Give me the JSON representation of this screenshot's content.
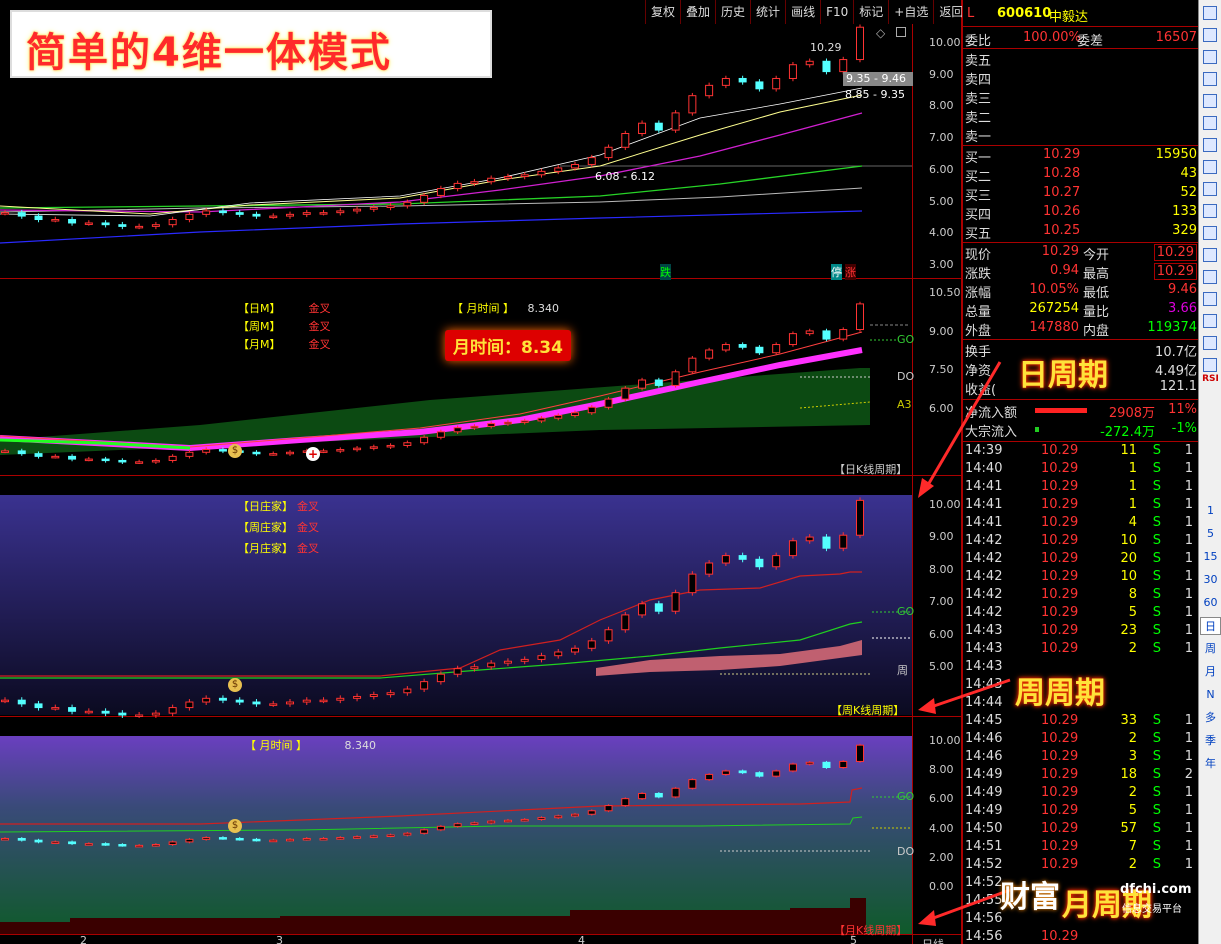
{
  "banner": {
    "title": "简单的4维一体模式"
  },
  "toolbar": [
    "复权",
    "叠加",
    "历史",
    "统计",
    "画线",
    "F10",
    "标记",
    "+自选",
    "返回"
  ],
  "stock": {
    "flag": "L",
    "code": "600610",
    "name": "中毅达"
  },
  "panel1": {
    "yticks": [
      "10.00",
      "9.00",
      "8.00",
      "7.00",
      "6.00",
      "5.00",
      "4.00",
      "3.00"
    ],
    "labels": {
      "price_top": "10.29",
      "range1": "9.35 - 9.46",
      "range2": "8.85 - 9.35",
      "range3": "6.08 - 6.12",
      "die": "跌",
      "ting": "停",
      "zhang": "涨"
    }
  },
  "panel2": {
    "yticks": [
      "10.50",
      "9.00",
      "7.50",
      "6.00"
    ],
    "legend": [
      {
        "k": "【日M】",
        "v": "金叉"
      },
      {
        "k": "【周M】",
        "v": "金叉"
      },
      {
        "k": "【月M】",
        "v": "金叉"
      }
    ],
    "month_time_label": "【 月时间 】",
    "month_time_value": "8.340",
    "highlight": "月时间：8.34",
    "levels": {
      "go": "GO",
      "do": "DO",
      "a3": "A3"
    },
    "footer": "【日K线周期】"
  },
  "panel3": {
    "yticks": [
      "10.00",
      "9.00",
      "8.00",
      "7.00",
      "6.00",
      "5.00"
    ],
    "legend": [
      {
        "k": "【日庄家】",
        "v": "金叉"
      },
      {
        "k": "【周庄家】",
        "v": "金叉"
      },
      {
        "k": "【月庄家】",
        "v": "金叉"
      }
    ],
    "levels": {
      "go": "GO",
      "zhou": "周"
    },
    "footer": "【周K线周期】"
  },
  "panel4": {
    "yticks": [
      "10.00",
      "8.00",
      "6.00",
      "4.00",
      "2.00",
      "0.00"
    ],
    "month_time_label": "【 月时间 】",
    "month_time_value": "8.340",
    "levels": {
      "go": "GO",
      "do": "DO"
    },
    "footer": "【月K线周期】",
    "xticks": [
      "2",
      "3",
      "4",
      "5"
    ],
    "bottom_label": "日线"
  },
  "callouts": {
    "day": "日周期",
    "week": "周周期",
    "month": "月周期"
  },
  "quote": {
    "weibi_label": "委比",
    "weibi": "100.00%",
    "weicha_label": "委差",
    "weicha": "16507",
    "asks": [
      "卖五",
      "卖四",
      "卖三",
      "卖二",
      "卖一"
    ],
    "bids": [
      {
        "l": "买一",
        "p": "10.29",
        "v": "15950"
      },
      {
        "l": "买二",
        "p": "10.28",
        "v": "43"
      },
      {
        "l": "买三",
        "p": "10.27",
        "v": "52"
      },
      {
        "l": "买四",
        "p": "10.26",
        "v": "133"
      },
      {
        "l": "买五",
        "p": "10.25",
        "v": "329"
      }
    ],
    "stats": [
      {
        "l": "现价",
        "v": "10.29",
        "l2": "今开",
        "v2": "10.29"
      },
      {
        "l": "涨跌",
        "v": "0.94",
        "l2": "最高",
        "v2": "10.29"
      },
      {
        "l": "涨幅",
        "v": "10.05%",
        "l2": "最低",
        "v2": "9.46"
      },
      {
        "l": "总量",
        "v": "267254",
        "l2": "量比",
        "v2": "3.66"
      },
      {
        "l": "外盘",
        "v": "147880",
        "l2": "内盘",
        "v2": "119374"
      }
    ],
    "extra": [
      {
        "l": "换手",
        "v": "10.7亿"
      },
      {
        "l": "净资",
        "v": "4.49亿"
      },
      {
        "l": "收益(",
        "v": "121.1"
      }
    ],
    "flow": [
      {
        "l": "净流入额",
        "v": "2908万",
        "p": "11%"
      },
      {
        "l": "大宗流入",
        "v": "-272.4万",
        "p": "-1%"
      }
    ],
    "ticks": [
      {
        "t": "14:39",
        "p": "10.29",
        "v": "11",
        "s": "S",
        "n": "1"
      },
      {
        "t": "14:40",
        "p": "10.29",
        "v": "1",
        "s": "S",
        "n": "1"
      },
      {
        "t": "14:41",
        "p": "10.29",
        "v": "1",
        "s": "S",
        "n": "1"
      },
      {
        "t": "14:41",
        "p": "10.29",
        "v": "1",
        "s": "S",
        "n": "1"
      },
      {
        "t": "14:41",
        "p": "10.29",
        "v": "4",
        "s": "S",
        "n": "1"
      },
      {
        "t": "14:42",
        "p": "10.29",
        "v": "10",
        "s": "S",
        "n": "1"
      },
      {
        "t": "14:42",
        "p": "10.29",
        "v": "20",
        "s": "S",
        "n": "1"
      },
      {
        "t": "14:42",
        "p": "10.29",
        "v": "10",
        "s": "S",
        "n": "1"
      },
      {
        "t": "14:42",
        "p": "10.29",
        "v": "8",
        "s": "S",
        "n": "1"
      },
      {
        "t": "14:42",
        "p": "10.29",
        "v": "5",
        "s": "S",
        "n": "1"
      },
      {
        "t": "14:43",
        "p": "10.29",
        "v": "23",
        "s": "S",
        "n": "1"
      },
      {
        "t": "14:43",
        "p": "10.29",
        "v": "2",
        "s": "S",
        "n": "1"
      },
      {
        "t": "14:43",
        "p": "",
        "v": "",
        "s": "",
        "n": ""
      },
      {
        "t": "14:43",
        "p": "",
        "v": "",
        "s": "",
        "n": ""
      },
      {
        "t": "14:44",
        "p": "",
        "v": "",
        "s": "",
        "n": ""
      },
      {
        "t": "14:45",
        "p": "10.29",
        "v": "33",
        "s": "S",
        "n": "1"
      },
      {
        "t": "14:46",
        "p": "10.29",
        "v": "2",
        "s": "S",
        "n": "1"
      },
      {
        "t": "14:46",
        "p": "10.29",
        "v": "3",
        "s": "S",
        "n": "1"
      },
      {
        "t": "14:49",
        "p": "10.29",
        "v": "18",
        "s": "S",
        "n": "2"
      },
      {
        "t": "14:49",
        "p": "10.29",
        "v": "2",
        "s": "S",
        "n": "1"
      },
      {
        "t": "14:49",
        "p": "10.29",
        "v": "5",
        "s": "S",
        "n": "1"
      },
      {
        "t": "14:50",
        "p": "10.29",
        "v": "57",
        "s": "S",
        "n": "1"
      },
      {
        "t": "14:51",
        "p": "10.29",
        "v": "7",
        "s": "S",
        "n": "1"
      },
      {
        "t": "14:52",
        "p": "10.29",
        "v": "2",
        "s": "S",
        "n": "1"
      },
      {
        "t": "14:52",
        "p": "",
        "v": "",
        "s": "",
        "n": ""
      },
      {
        "t": "14:55",
        "p": "",
        "v": "",
        "s": "",
        "n": ""
      },
      {
        "t": "14:56",
        "p": "",
        "v": "",
        "s": "",
        "n": ""
      },
      {
        "t": "14:56",
        "p": "10.29",
        "v": "",
        "s": "",
        "n": ""
      }
    ]
  },
  "sidebar": {
    "periods": [
      "1",
      "5",
      "15",
      "30",
      "60",
      "日",
      "周",
      "月",
      "N",
      "多",
      "季",
      "年"
    ],
    "icons": [
      "rsi-icon",
      "wr-icon"
    ],
    "rsi": "RSI"
  },
  "watermark": {
    "main": "财富",
    "domain": "dfchi.com",
    "sub": "信息交易平台"
  },
  "colors": {
    "up": "#ff3333",
    "down": "#54ffff",
    "panel_border": "#aa0000",
    "yellow": "#ffff00"
  },
  "chart_data": {
    "type": "candlestick",
    "series_note": "daily candles, approximate closes",
    "x": [
      "2",
      "3",
      "4",
      "5"
    ],
    "close": [
      4.9,
      4.8,
      4.7,
      4.7,
      4.6,
      4.6,
      4.55,
      4.5,
      4.5,
      4.55,
      4.7,
      4.85,
      4.95,
      4.9,
      4.85,
      4.8,
      4.8,
      4.85,
      4.9,
      4.9,
      4.95,
      5.0,
      5.05,
      5.1,
      5.2,
      5.4,
      5.6,
      5.75,
      5.8,
      5.9,
      5.95,
      6.0,
      6.1,
      6.2,
      6.3,
      6.5,
      6.8,
      7.2,
      7.5,
      7.3,
      7.8,
      8.3,
      8.6,
      8.8,
      8.7,
      8.5,
      8.8,
      9.2,
      9.3,
      9.0,
      9.35,
      10.29
    ]
  }
}
